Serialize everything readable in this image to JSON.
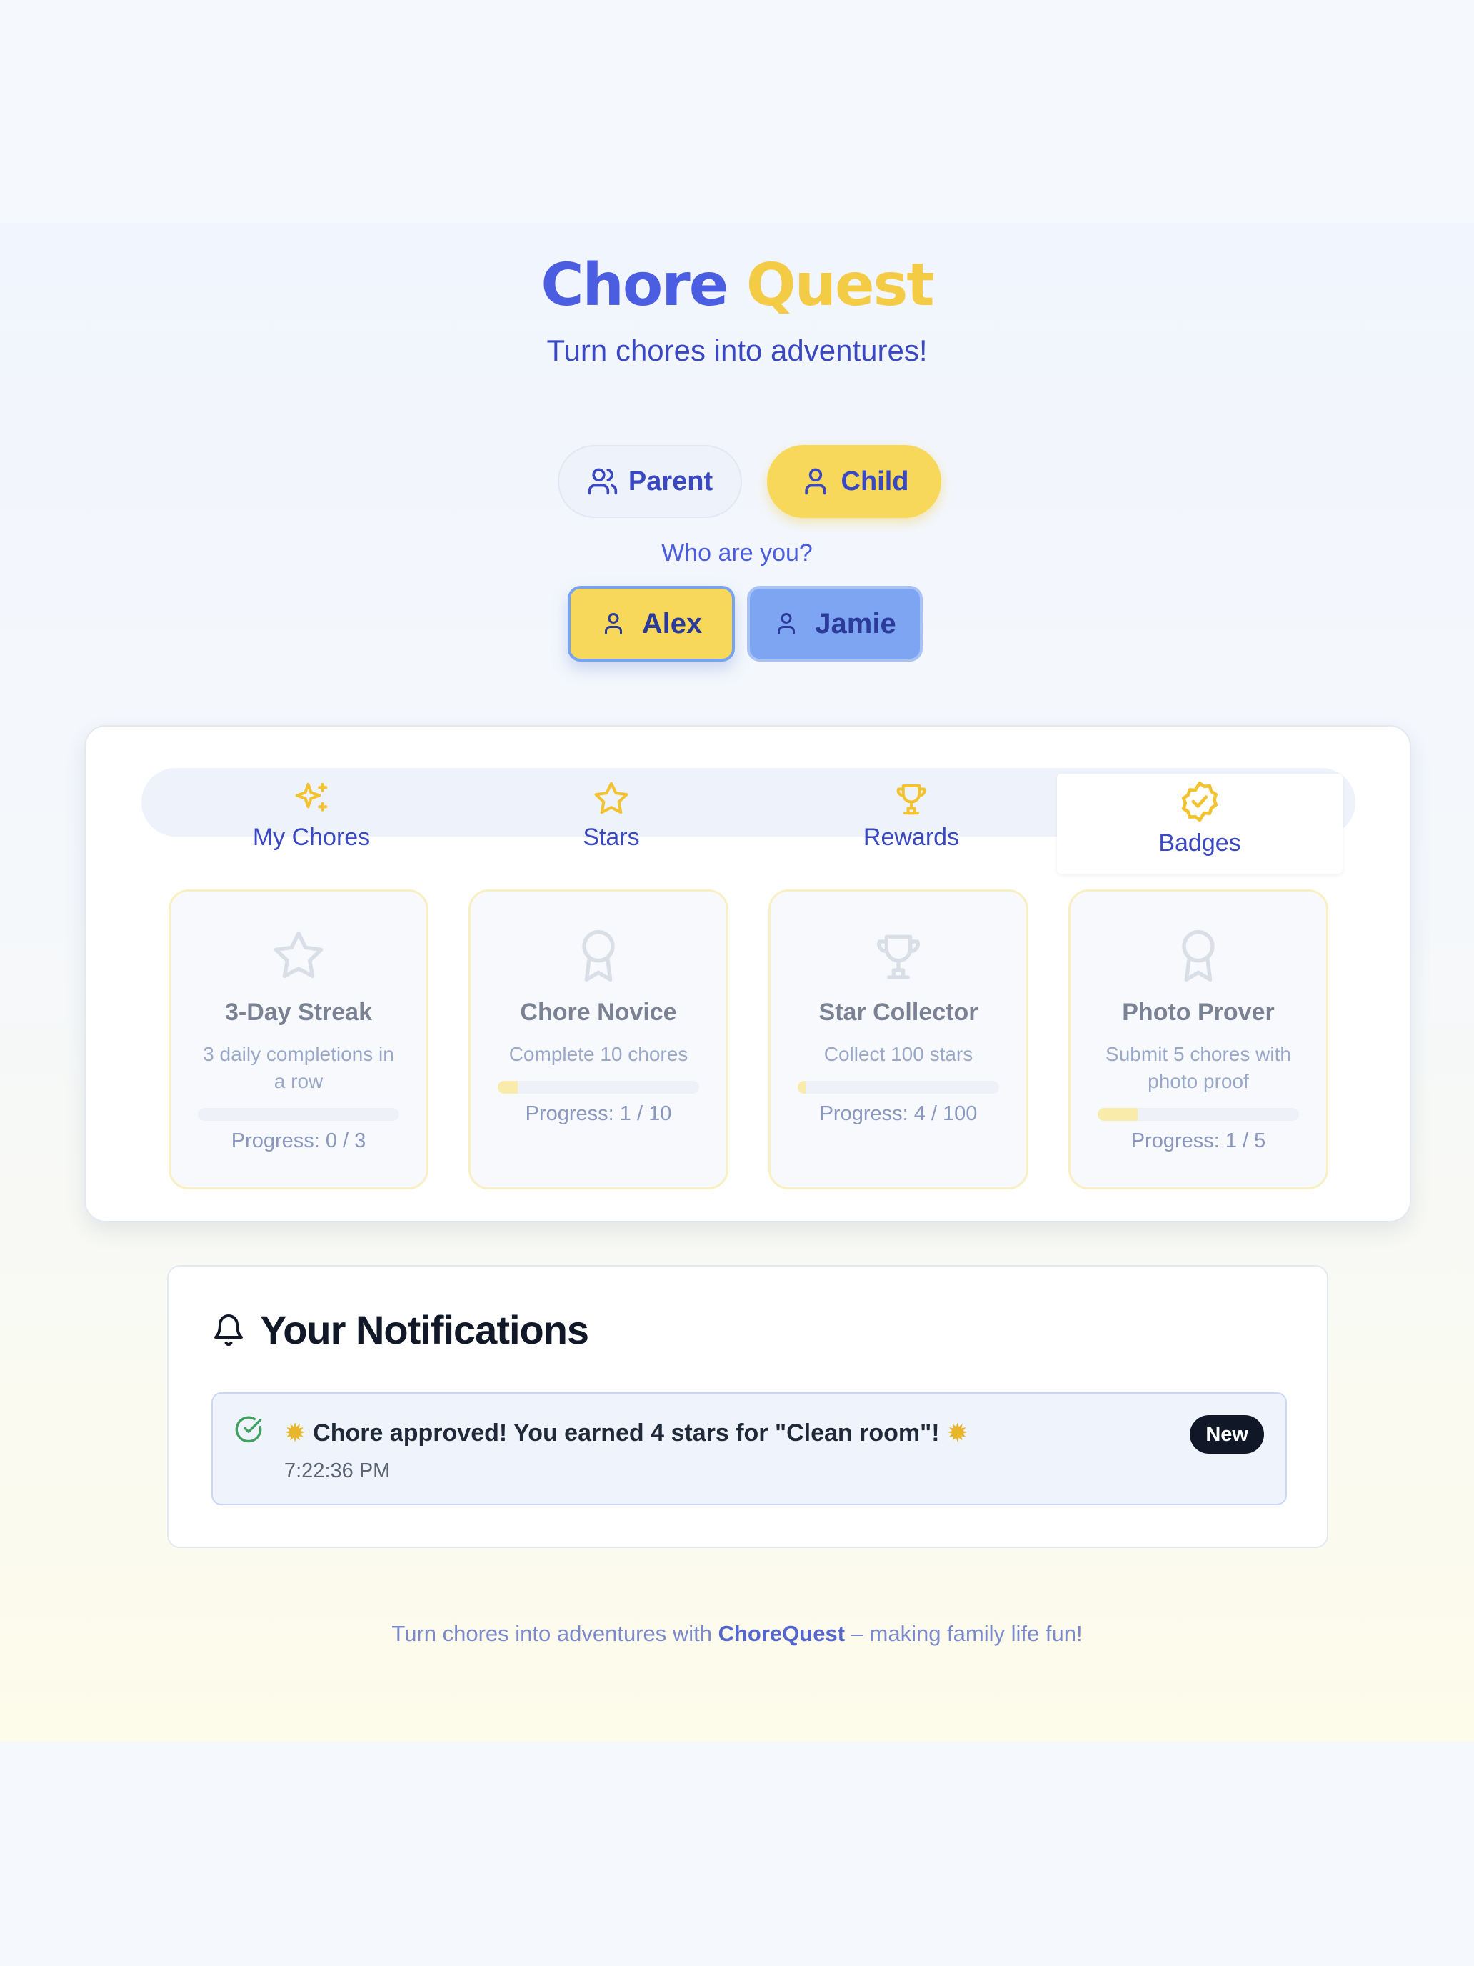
{
  "header": {
    "title_part1": "Chore",
    "title_part2": "Quest",
    "subtitle": "Turn chores into adventures!"
  },
  "roles": {
    "parent_label": "Parent",
    "child_label": "Child",
    "selected": "Child"
  },
  "who": {
    "prompt": "Who are you?",
    "kids": [
      "Alex",
      "Jamie"
    ],
    "selected": "Alex"
  },
  "tabs": [
    {
      "label": "My Chores",
      "icon": "sparkles-icon"
    },
    {
      "label": "Stars",
      "icon": "star-icon"
    },
    {
      "label": "Rewards",
      "icon": "trophy-icon"
    },
    {
      "label": "Badges",
      "icon": "badge-check-icon",
      "active": true
    }
  ],
  "badges": [
    {
      "name": "3-Day Streak",
      "desc": "3 daily completions in a row",
      "progress_text": "Progress: 0 / 3",
      "progress": 0,
      "icon": "star-icon"
    },
    {
      "name": "Chore Novice",
      "desc": "Complete 10 chores",
      "progress_text": "Progress: 1 / 10",
      "progress": 0.1,
      "icon": "award-icon"
    },
    {
      "name": "Star Collector",
      "desc": "Collect 100 stars",
      "progress_text": "Progress: 4 / 100",
      "progress": 0.04,
      "icon": "trophy-icon"
    },
    {
      "name": "Photo Prover",
      "desc": "Submit 5 chores with photo proof",
      "progress_text": "Progress: 1 / 5",
      "progress": 0.2,
      "icon": "award-icon"
    }
  ],
  "notifications": {
    "heading": "Your Notifications",
    "items": [
      {
        "message": "Chore approved! You earned 4 stars for \"Clean room\"!",
        "time": "7:22:36 PM",
        "badge": "New"
      }
    ]
  },
  "footer": {
    "prefix": "Turn chores into adventures with",
    "brand": "ChoreQuest",
    "suffix": "– making family life fun!"
  },
  "colors": {
    "primary": "#4b5de0",
    "accent": "#f4cb45",
    "kid_selected": "#f7d85a",
    "kid_other": "#7ea5f2"
  }
}
